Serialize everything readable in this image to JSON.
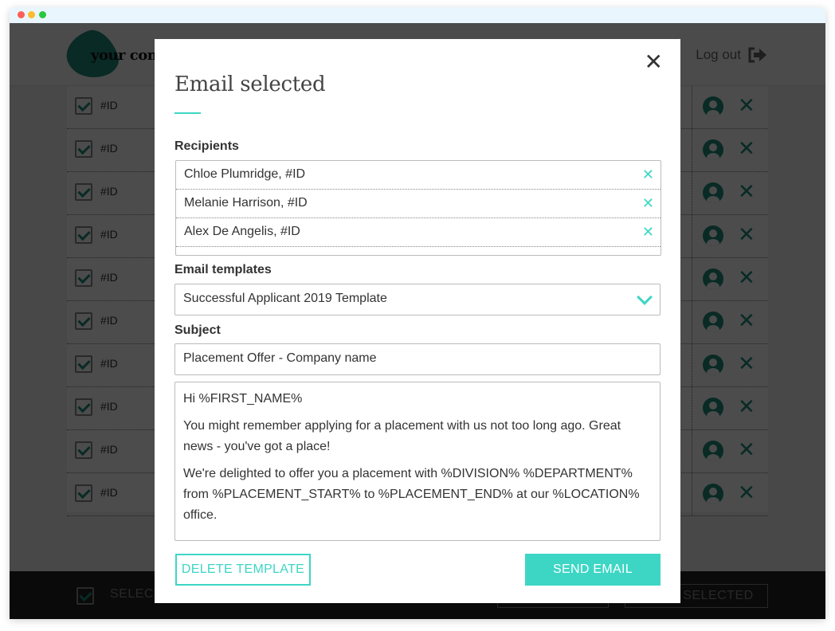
{
  "header": {
    "logo_text": "your company",
    "logout_label": "Log out",
    "logout_icon": "sign-out-icon"
  },
  "table": {
    "rows": [
      {
        "id": "#ID",
        "checked": true
      },
      {
        "id": "#ID",
        "checked": true
      },
      {
        "id": "#ID",
        "checked": true
      },
      {
        "id": "#ID",
        "checked": true
      },
      {
        "id": "#ID",
        "checked": true
      },
      {
        "id": "#ID",
        "checked": true
      },
      {
        "id": "#ID",
        "checked": true
      },
      {
        "id": "#ID",
        "checked": true
      },
      {
        "id": "#ID",
        "checked": true
      },
      {
        "id": "#ID",
        "checked": true
      }
    ],
    "row_icons": [
      "user-circle-icon",
      "close-icon"
    ]
  },
  "footer": {
    "select_label": "SELECT ALL",
    "action_label": "EMAIL SELECTED"
  },
  "modal": {
    "title": "Email selected",
    "close_icon": "close-icon",
    "recipients_label": "Recipients",
    "recipients": [
      {
        "name": "Chloe Plumridge, #ID"
      },
      {
        "name": "Melanie Harrison, #ID"
      },
      {
        "name": "Alex De Angelis, #ID"
      }
    ],
    "templates_label": "Email templates",
    "template_selected": "Successful Applicant 2019 Template",
    "subject_label": "Subject",
    "subject_value": "Placement Offer - Company name",
    "body": [
      "Hi %FIRST_NAME%",
      "You might remember applying for a placement with us not too long ago. Great news - you've got a place!",
      "We're delighted to offer you a placement with %DIVISION% %DEPARTMENT% from %PLACEMENT_START% to %PLACEMENT_END% at our %LOCATION% office."
    ],
    "delete_label": "DELETE TEMPLATE",
    "send_label": "SEND EMAIL"
  },
  "colors": {
    "accent": "#3dd6c5",
    "brand_dark": "#1f8c7c"
  }
}
